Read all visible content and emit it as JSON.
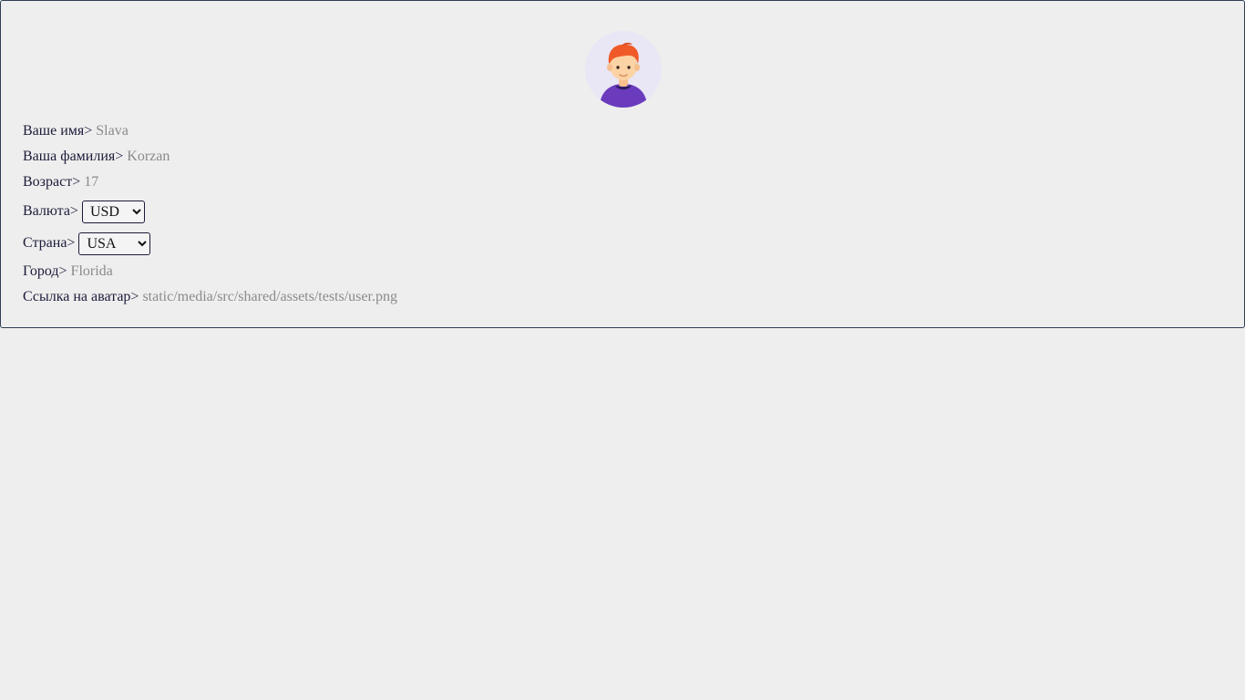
{
  "profile": {
    "avatar_icon": "user-avatar-icon",
    "fields": {
      "first_name": {
        "label": "Ваше имя>",
        "value": "Slava"
      },
      "last_name": {
        "label": "Ваша фамилия>",
        "value": "Korzan"
      },
      "age": {
        "label": "Возраст>",
        "value": "17"
      },
      "currency": {
        "label": "Валюта>",
        "selected": "USD"
      },
      "country": {
        "label": "Страна>",
        "selected": "USA"
      },
      "city": {
        "label": "Город>",
        "value": "Florida"
      },
      "avatar_link": {
        "label": "Ссылка на аватар>",
        "value": "static/media/src/shared/assets/tests/user.png"
      }
    }
  },
  "colors": {
    "background": "#eeeeee",
    "border": "#2e3e55",
    "label": "#1b1b3a",
    "value": "#8a8a8a",
    "avatar_bg": "#e9e6f5",
    "hair": "#f05a28",
    "shirt": "#6a3bbd"
  }
}
